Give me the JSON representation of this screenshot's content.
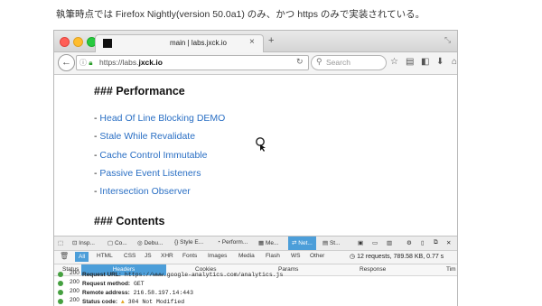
{
  "caption": "執筆時点では Firefox Nightly(version 50.0a1) のみ、かつ https のみで実装されている。",
  "browser": {
    "tab_title": "main | labs.jxck.io",
    "tab_close": "×",
    "new_tab": "+",
    "url_prefix": "https://labs.",
    "url_domain": "jxck.io",
    "search_placeholder": "Search"
  },
  "page": {
    "heading_performance": "### Performance",
    "links": [
      {
        "dash": "- ",
        "label": "Head Of Line Blocking DEMO"
      },
      {
        "dash": "- ",
        "label": "Stale While Revalidate"
      },
      {
        "dash": "- ",
        "label": "Cache Control Immutable"
      },
      {
        "dash": "- ",
        "label": "Passive Event Listeners"
      },
      {
        "dash": "- ",
        "label": "Intersection Observer"
      }
    ],
    "heading_contents": "### Contents"
  },
  "devtools": {
    "tabs": [
      "Insp...",
      "Co...",
      "Debu...",
      "Style E...",
      "Perform...",
      "Me...",
      "Net...",
      "St..."
    ],
    "active_tab": "Net...",
    "filters": [
      "All",
      "HTML",
      "CSS",
      "JS",
      "XHR",
      "Fonts",
      "Images",
      "Media",
      "Flash",
      "WS",
      "Other"
    ],
    "active_filter": "All",
    "summary": "12 requests, 789.58 KB, 0.77 s",
    "columns": {
      "status": "Status",
      "headers": "Headers",
      "cookies": "Cookies",
      "params": "Params",
      "response": "Response",
      "timings": "Tim"
    },
    "row_statuses": [
      "200",
      "200",
      "200",
      "200"
    ],
    "details": {
      "request_url_label": "Request URL:",
      "request_url": "https://www.google-analytics.com/analytics.js",
      "method_label": "Request method:",
      "method": "GET",
      "remote_label": "Remote address:",
      "remote": "216.58.197.14:443",
      "status_label": "Status code:",
      "status_value": "304 Not Modified"
    }
  },
  "colors": {
    "link": "#2a6fc4",
    "devtools_active": "#4c9ed9",
    "status_ok": "#45a040"
  }
}
